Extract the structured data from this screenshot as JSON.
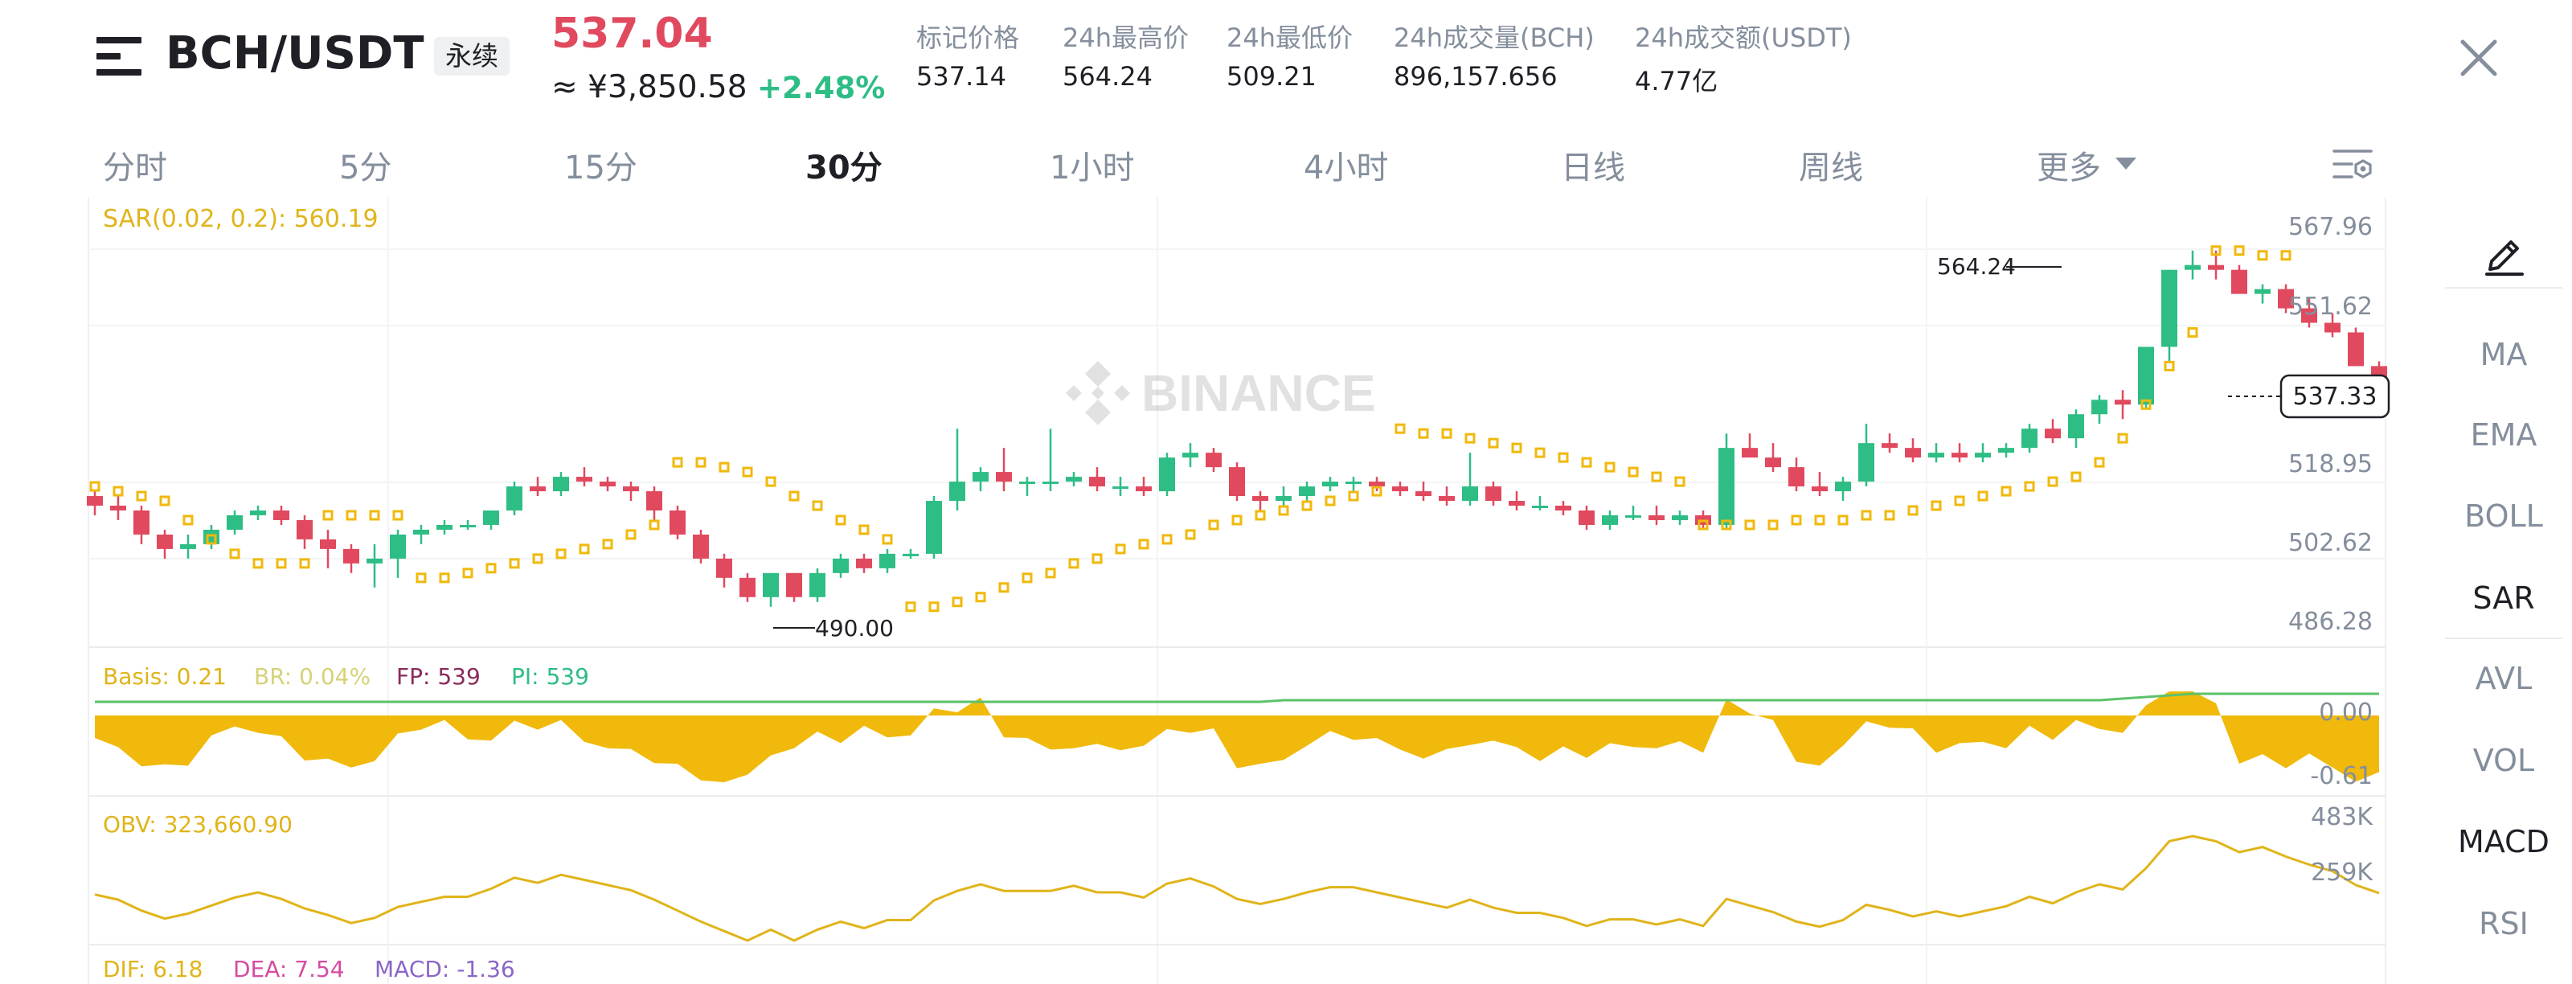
{
  "header": {
    "symbol": "BCH/USDT",
    "contract_type": "永续",
    "last_price": "537.04",
    "cny_price": "≈ ¥3,850.58",
    "change_pct": "+2.48%",
    "stats": [
      {
        "label": "标记价格",
        "value": "537.14"
      },
      {
        "label": "24h最高价",
        "value": "564.24"
      },
      {
        "label": "24h最低价",
        "value": "509.21"
      },
      {
        "label": "24h成交量(BCH)",
        "value": "896,157.656"
      },
      {
        "label": "24h成交额(USDT)",
        "value": "4.77亿"
      }
    ]
  },
  "timeframes": {
    "items": [
      "分时",
      "5分",
      "15分",
      "30分",
      "1小时",
      "4小时",
      "日线",
      "周线",
      "更多"
    ],
    "active": "30分"
  },
  "chart": {
    "watermark": "BINANCE",
    "sar_label": "SAR(0.02, 0.2): 560.19",
    "price_axis": [
      "567.96",
      "551.62",
      "518.95",
      "502.62",
      "486.28"
    ],
    "current_price": "537.33",
    "high_marker": "564.24",
    "low_marker": "490.00",
    "basis_legend": {
      "basis": "Basis: 0.21",
      "br": "BR: 0.04%",
      "fp": "FP: 539",
      "pi": "PI: 539"
    },
    "basis_axis": [
      "0.00",
      "-0.61"
    ],
    "obv_legend": "OBV: 323,660.90",
    "obv_axis": [
      "483K",
      "259K"
    ],
    "macd_legend": {
      "dif": "DIF: 6.18",
      "dea": "DEA: 7.54",
      "macd": "MACD: -1.36"
    }
  },
  "indicators": {
    "items": [
      "MA",
      "EMA",
      "BOLL",
      "SAR",
      "AVL",
      "VOL",
      "MACD",
      "RSI"
    ],
    "active": [
      "SAR",
      "MACD"
    ]
  },
  "colors": {
    "up": "#2ebd85",
    "down": "#e0495e",
    "sar": "#f0b90b",
    "muted": "#848e9c"
  },
  "chart_data": {
    "type": "candlestick",
    "interval": "30分",
    "ohlc": [
      [
        513,
        514,
        509,
        511
      ],
      [
        511,
        513,
        508,
        510
      ],
      [
        510,
        511,
        503,
        505
      ],
      [
        505,
        506,
        500,
        502
      ],
      [
        502,
        505,
        500,
        503
      ],
      [
        503,
        507,
        502,
        506
      ],
      [
        506,
        510,
        505,
        509
      ],
      [
        509,
        511,
        508,
        510
      ],
      [
        510,
        511,
        507,
        508
      ],
      [
        508,
        509,
        502,
        504
      ],
      [
        504,
        506,
        498,
        502
      ],
      [
        502,
        503,
        497,
        499
      ],
      [
        499,
        503,
        494,
        500
      ],
      [
        500,
        506,
        496,
        505
      ],
      [
        505,
        507,
        503,
        506
      ],
      [
        506,
        508,
        505,
        507
      ],
      [
        507,
        508,
        506,
        507
      ],
      [
        507,
        510,
        506,
        510
      ],
      [
        510,
        516,
        509,
        515
      ],
      [
        515,
        517,
        513,
        514
      ],
      [
        514,
        518,
        513,
        517
      ],
      [
        517,
        519,
        515,
        516
      ],
      [
        516,
        517,
        514,
        515
      ],
      [
        515,
        516,
        512,
        514
      ],
      [
        514,
        515,
        508,
        510
      ],
      [
        510,
        511,
        504,
        505
      ],
      [
        505,
        506,
        499,
        500
      ],
      [
        500,
        501,
        494,
        496
      ],
      [
        496,
        497,
        491,
        492
      ],
      [
        492,
        497,
        490,
        497
      ],
      [
        497,
        497,
        491,
        492
      ],
      [
        492,
        498,
        491,
        497
      ],
      [
        497,
        501,
        496,
        500
      ],
      [
        500,
        501,
        497,
        498
      ],
      [
        498,
        502,
        497,
        501
      ],
      [
        501,
        502,
        500,
        501
      ],
      [
        501,
        513,
        500,
        512
      ],
      [
        512,
        527,
        510,
        516
      ],
      [
        516,
        519,
        514,
        518
      ],
      [
        518,
        523,
        514,
        516
      ],
      [
        516,
        517,
        513,
        516
      ],
      [
        516,
        527,
        514,
        516
      ],
      [
        516,
        518,
        515,
        517
      ],
      [
        517,
        519,
        514,
        515
      ],
      [
        515,
        517,
        513,
        515
      ],
      [
        515,
        517,
        513,
        514
      ],
      [
        514,
        522,
        513,
        521
      ],
      [
        521,
        524,
        519,
        522
      ],
      [
        522,
        523,
        518,
        519
      ],
      [
        519,
        520,
        512,
        513
      ],
      [
        513,
        514,
        510,
        512
      ],
      [
        512,
        515,
        511,
        513
      ],
      [
        513,
        516,
        512,
        515
      ],
      [
        515,
        517,
        514,
        516
      ],
      [
        516,
        517,
        514,
        516
      ],
      [
        516,
        517,
        514,
        515
      ],
      [
        515,
        516,
        513,
        514
      ],
      [
        514,
        516,
        512,
        513
      ],
      [
        513,
        515,
        511,
        512
      ],
      [
        512,
        522,
        511,
        515
      ],
      [
        515,
        516,
        511,
        512
      ],
      [
        512,
        514,
        510,
        511
      ],
      [
        511,
        513,
        510,
        511
      ],
      [
        511,
        512,
        509,
        510
      ],
      [
        510,
        511,
        506,
        507
      ],
      [
        507,
        510,
        506,
        509
      ],
      [
        509,
        511,
        508,
        509
      ],
      [
        509,
        511,
        507,
        508
      ],
      [
        508,
        510,
        507,
        509
      ],
      [
        509,
        510,
        506,
        507
      ],
      [
        507,
        526,
        506,
        523
      ],
      [
        523,
        526,
        521,
        521
      ],
      [
        521,
        524,
        518,
        519
      ],
      [
        519,
        521,
        514,
        515
      ],
      [
        515,
        518,
        513,
        514
      ],
      [
        514,
        517,
        512,
        516
      ],
      [
        516,
        528,
        515,
        524
      ],
      [
        524,
        526,
        522,
        523
      ],
      [
        523,
        525,
        520,
        521
      ],
      [
        521,
        524,
        520,
        522
      ],
      [
        522,
        524,
        520,
        521
      ],
      [
        521,
        524,
        520,
        522
      ],
      [
        522,
        524,
        521,
        523
      ],
      [
        523,
        528,
        522,
        527
      ],
      [
        527,
        529,
        524,
        525
      ],
      [
        525,
        531,
        523,
        530
      ],
      [
        530,
        534,
        528,
        533
      ],
      [
        533,
        535,
        529,
        532
      ],
      [
        532,
        544,
        531,
        544
      ],
      [
        544,
        560,
        541,
        560
      ],
      [
        560,
        564,
        558,
        561
      ],
      [
        561,
        564,
        558,
        560
      ],
      [
        560,
        561,
        556,
        555
      ],
      [
        555,
        557,
        553,
        556
      ],
      [
        556,
        557,
        551,
        552
      ],
      [
        552,
        554,
        548,
        549
      ],
      [
        549,
        551,
        546,
        547
      ],
      [
        547,
        548,
        540,
        540
      ],
      [
        540,
        541,
        536,
        537
      ]
    ],
    "sar": [
      [
        0,
        515
      ],
      [
        1,
        514
      ],
      [
        2,
        513
      ],
      [
        3,
        512
      ],
      [
        4,
        508
      ],
      [
        5,
        504
      ],
      [
        6,
        501
      ],
      [
        7,
        499
      ],
      [
        8,
        499
      ],
      [
        9,
        499
      ],
      [
        10,
        509
      ],
      [
        11,
        509
      ],
      [
        12,
        509
      ],
      [
        13,
        509
      ],
      [
        14,
        496
      ],
      [
        15,
        496
      ],
      [
        16,
        497
      ],
      [
        17,
        498
      ],
      [
        18,
        499
      ],
      [
        19,
        500
      ],
      [
        20,
        501
      ],
      [
        21,
        502
      ],
      [
        22,
        503
      ],
      [
        23,
        505
      ],
      [
        24,
        507
      ],
      [
        25,
        520
      ],
      [
        26,
        520
      ],
      [
        27,
        519
      ],
      [
        28,
        518
      ],
      [
        29,
        516
      ],
      [
        30,
        513
      ],
      [
        31,
        511
      ],
      [
        32,
        508
      ],
      [
        33,
        506
      ],
      [
        34,
        504
      ],
      [
        35,
        490
      ],
      [
        36,
        490
      ],
      [
        37,
        491
      ],
      [
        38,
        492
      ],
      [
        39,
        494
      ],
      [
        40,
        496
      ],
      [
        41,
        497
      ],
      [
        42,
        499
      ],
      [
        43,
        500
      ],
      [
        44,
        502
      ],
      [
        45,
        503
      ],
      [
        46,
        504
      ],
      [
        47,
        505
      ],
      [
        48,
        507
      ],
      [
        49,
        508
      ],
      [
        50,
        509
      ],
      [
        51,
        510
      ],
      [
        52,
        511
      ],
      [
        53,
        512
      ],
      [
        54,
        513
      ],
      [
        55,
        514
      ],
      [
        56,
        527
      ],
      [
        57,
        526
      ],
      [
        58,
        526
      ],
      [
        59,
        525
      ],
      [
        60,
        524
      ],
      [
        61,
        523
      ],
      [
        62,
        522
      ],
      [
        63,
        521
      ],
      [
        64,
        520
      ],
      [
        65,
        519
      ],
      [
        66,
        518
      ],
      [
        67,
        517
      ],
      [
        68,
        516
      ],
      [
        69,
        507
      ],
      [
        70,
        507
      ],
      [
        71,
        507
      ],
      [
        72,
        507
      ],
      [
        73,
        508
      ],
      [
        74,
        508
      ],
      [
        75,
        508
      ],
      [
        76,
        509
      ],
      [
        77,
        509
      ],
      [
        78,
        510
      ],
      [
        79,
        511
      ],
      [
        80,
        512
      ],
      [
        81,
        513
      ],
      [
        82,
        514
      ],
      [
        83,
        515
      ],
      [
        84,
        516
      ],
      [
        85,
        517
      ],
      [
        86,
        520
      ],
      [
        87,
        525
      ],
      [
        88,
        532
      ],
      [
        89,
        540
      ],
      [
        90,
        547
      ],
      [
        91,
        564
      ],
      [
        92,
        564
      ],
      [
        93,
        563
      ],
      [
        94,
        563
      ]
    ],
    "price_axis": [
      486.28,
      502.62,
      518.95,
      551.62,
      567.96
    ],
    "basis": {
      "range": [
        -0.61,
        0.0
      ]
    },
    "obv": {
      "range_labels": [
        "259K",
        "483K"
      ]
    }
  }
}
